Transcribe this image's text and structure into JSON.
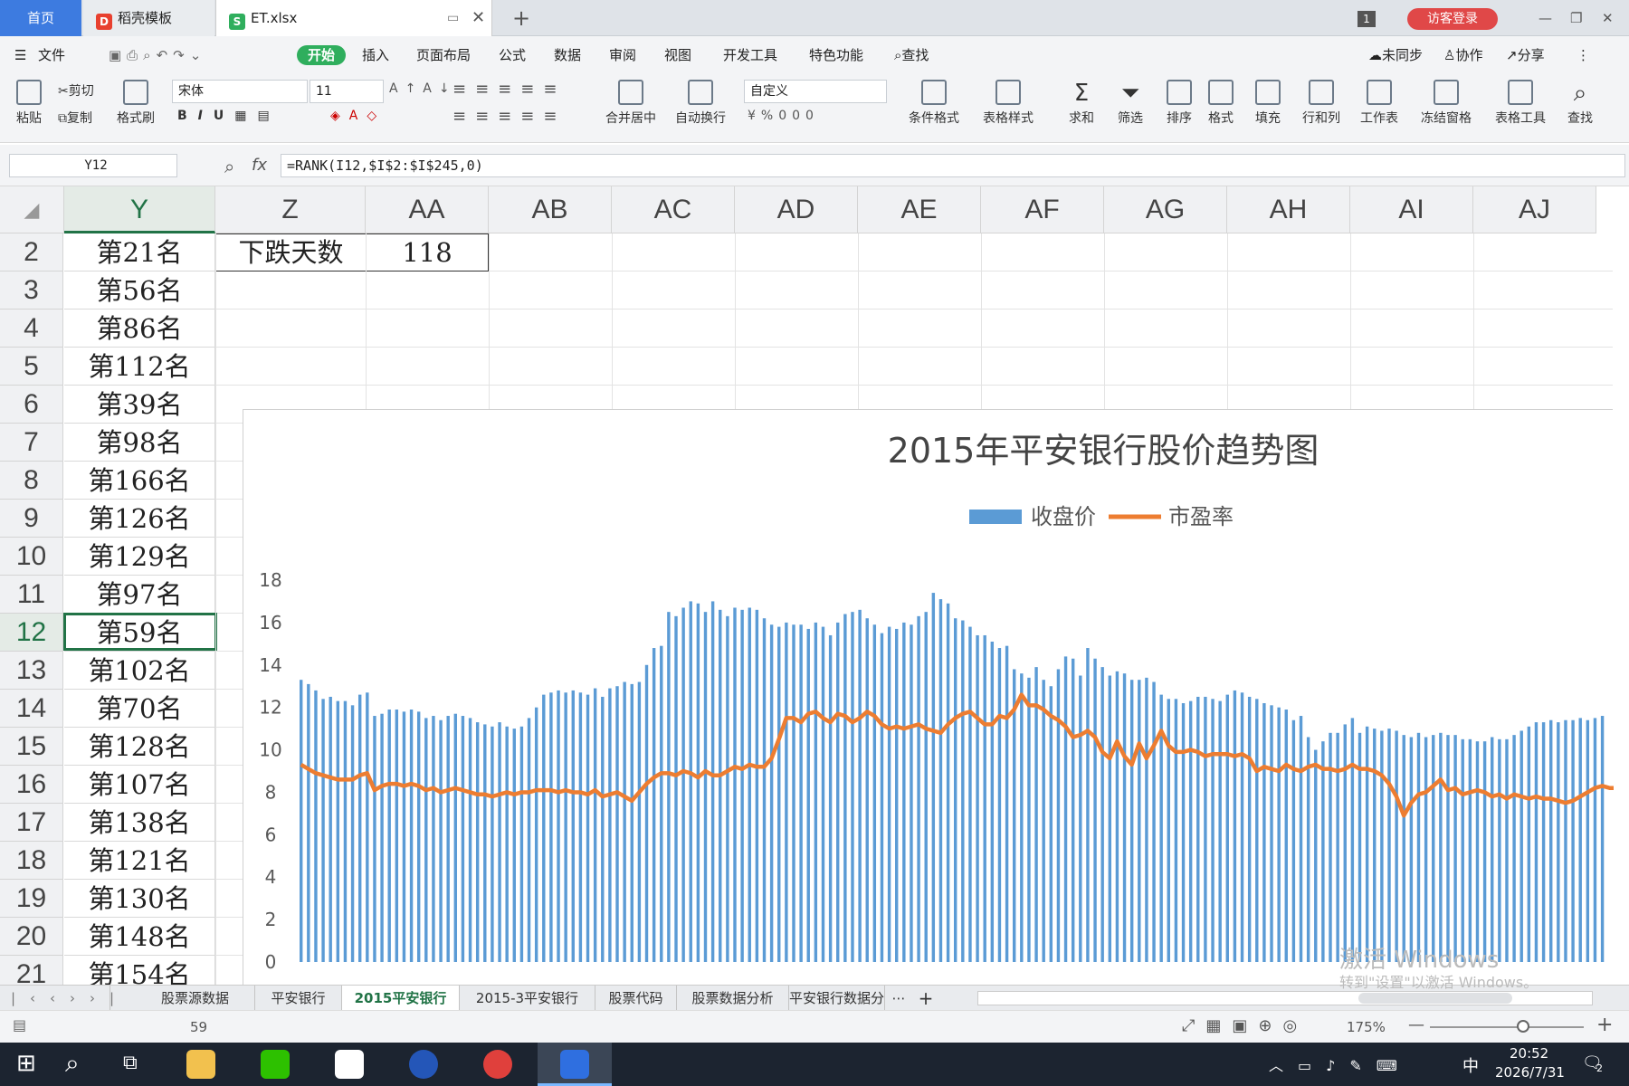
{
  "tabs": {
    "home": "首页",
    "docer": "稻壳模板",
    "file": "ET.xlsx",
    "badge": "1",
    "login": "访客登录"
  },
  "menu": {
    "file": "文件",
    "start": "开始",
    "insert": "插入",
    "layout": "页面布局",
    "formula": "公式",
    "data": "数据",
    "review": "审阅",
    "view": "视图",
    "dev": "开发工具",
    "special": "特色功能",
    "search": "查找",
    "unsync": "未同步",
    "collab": "协作",
    "share": "分享"
  },
  "ribbon": {
    "paste": "粘贴",
    "cut": "剪切",
    "copy": "复制",
    "format_painter": "格式刷",
    "font": "宋体",
    "size": "11",
    "merge": "合并居中",
    "wrap": "自动换行",
    "numfmt": "自定义",
    "cond": "条件格式",
    "tablestyle": "表格样式",
    "sum": "求和",
    "filter": "筛选",
    "sort": "排序",
    "format": "格式",
    "fill": "填充",
    "rowcol": "行和列",
    "sheet": "工作表",
    "freeze": "冻结窗格",
    "tabletool": "表格工具",
    "find": "查找"
  },
  "formula_bar": {
    "namebox": "Y12",
    "fx": "fx",
    "formula": "=RANK(I12,$I$2:$I$245,0)"
  },
  "columns": [
    "Y",
    "Z",
    "AA",
    "AB",
    "AC",
    "AD",
    "AE",
    "AF",
    "AG",
    "AH",
    "AI",
    "AJ"
  ],
  "rows": [
    {
      "n": "2",
      "y": "第21名"
    },
    {
      "n": "3",
      "y": "第56名"
    },
    {
      "n": "4",
      "y": "第86名"
    },
    {
      "n": "5",
      "y": "第112名"
    },
    {
      "n": "6",
      "y": "第39名"
    },
    {
      "n": "7",
      "y": "第98名"
    },
    {
      "n": "8",
      "y": "第166名"
    },
    {
      "n": "9",
      "y": "第126名"
    },
    {
      "n": "10",
      "y": "第129名"
    },
    {
      "n": "11",
      "y": "第97名"
    },
    {
      "n": "12",
      "y": "第59名"
    },
    {
      "n": "13",
      "y": "第102名"
    },
    {
      "n": "14",
      "y": "第70名"
    },
    {
      "n": "15",
      "y": "第128名"
    },
    {
      "n": "16",
      "y": "第107名"
    },
    {
      "n": "17",
      "y": "第138名"
    },
    {
      "n": "18",
      "y": "第121名"
    },
    {
      "n": "19",
      "y": "第130名"
    },
    {
      "n": "20",
      "y": "第148名"
    },
    {
      "n": "21",
      "y": "第154名"
    }
  ],
  "cells": {
    "Z2": "下跌天数",
    "AA2": "118"
  },
  "chart_data": {
    "type": "bar",
    "title": "2015年平安银行股价趋势图",
    "ylim": [
      0,
      18
    ],
    "yticks": [
      "0",
      "2",
      "4",
      "6",
      "8",
      "10",
      "12",
      "14",
      "16",
      "18"
    ],
    "series": [
      {
        "name": "收盘价",
        "type": "bar",
        "color": "#5b9bd5",
        "values": [
          13.3,
          13.1,
          12.8,
          12.4,
          12.5,
          12.3,
          12.3,
          12.1,
          12.6,
          12.7,
          11.6,
          11.7,
          11.9,
          11.9,
          11.8,
          11.9,
          11.8,
          11.5,
          11.6,
          11.4,
          11.6,
          11.7,
          11.6,
          11.5,
          11.3,
          11.2,
          11.1,
          11.3,
          11.1,
          11.0,
          11.1,
          11.5,
          12.0,
          12.6,
          12.7,
          12.8,
          12.7,
          12.8,
          12.7,
          12.6,
          12.9,
          12.5,
          12.9,
          13.0,
          13.2,
          13.1,
          13.2,
          14.0,
          14.8,
          14.9,
          16.5,
          16.3,
          16.7,
          17.0,
          16.9,
          16.5,
          17.0,
          16.6,
          16.3,
          16.7,
          16.6,
          16.7,
          16.6,
          16.2,
          15.9,
          15.8,
          16.0,
          15.9,
          15.9,
          15.7,
          16.0,
          15.8,
          15.4,
          16.0,
          16.4,
          16.5,
          16.6,
          16.2,
          15.9,
          15.5,
          15.8,
          15.7,
          16.0,
          15.9,
          16.3,
          16.5,
          17.4,
          17.1,
          16.9,
          16.2,
          16.1,
          15.8,
          15.4,
          15.4,
          15.1,
          14.8,
          14.9,
          13.8,
          13.6,
          13.4,
          13.9,
          13.3,
          13.0,
          13.8,
          14.4,
          14.3,
          13.5,
          14.8,
          14.3,
          13.9,
          13.5,
          13.7,
          13.6,
          13.3,
          13.3,
          13.4,
          13.2,
          12.6,
          12.4,
          12.4,
          12.2,
          12.3,
          12.5,
          12.5,
          12.4,
          12.3,
          12.6,
          12.8,
          12.7,
          12.5,
          12.4,
          12.2,
          12.1,
          12.0,
          11.9,
          11.4,
          11.6,
          10.6,
          10.0,
          10.4,
          10.8,
          10.8,
          11.2,
          11.5,
          10.8,
          11.1,
          11.0,
          10.9,
          11.0,
          10.9,
          10.7,
          10.6,
          10.8,
          10.6,
          10.7,
          10.8,
          10.7,
          10.7,
          10.5,
          10.5,
          10.4,
          10.4,
          10.6,
          10.5,
          10.5,
          10.7,
          10.9,
          11.1,
          11.3,
          11.3,
          11.4,
          11.3,
          11.4,
          11.4,
          11.5,
          11.4,
          11.5,
          11.6
        ]
      },
      {
        "name": "市盈率",
        "type": "line",
        "color": "#ed7d31",
        "values": [
          9.3,
          9.1,
          8.9,
          8.8,
          8.7,
          8.6,
          8.6,
          8.6,
          8.8,
          8.9,
          8.1,
          8.3,
          8.4,
          8.4,
          8.3,
          8.4,
          8.3,
          8.1,
          8.2,
          8.0,
          8.1,
          8.2,
          8.1,
          8.0,
          7.9,
          7.9,
          7.8,
          7.9,
          8.0,
          7.9,
          8.0,
          8.0,
          8.1,
          8.1,
          8.1,
          8.0,
          8.1,
          8.0,
          8.0,
          7.9,
          8.1,
          7.8,
          7.9,
          8.0,
          7.8,
          7.6,
          8.0,
          8.4,
          8.7,
          8.9,
          8.9,
          8.8,
          9.0,
          8.9,
          8.7,
          9.0,
          8.8,
          8.8,
          9.0,
          9.2,
          9.1,
          9.3,
          9.2,
          9.2,
          9.6,
          10.5,
          11.5,
          11.5,
          11.3,
          11.7,
          11.8,
          11.5,
          11.3,
          11.7,
          11.6,
          11.3,
          11.5,
          11.8,
          11.6,
          11.2,
          11.0,
          11.1,
          11.0,
          11.1,
          11.2,
          11.0,
          10.9,
          10.8,
          11.2,
          11.5,
          11.7,
          11.8,
          11.5,
          11.2,
          11.2,
          11.6,
          11.5,
          11.9,
          12.6,
          12.1,
          12.1,
          11.9,
          11.6,
          11.4,
          11.1,
          10.6,
          10.7,
          10.9,
          10.6,
          9.9,
          9.6,
          10.4,
          9.7,
          9.3,
          10.3,
          9.6,
          10.2,
          10.9,
          10.2,
          9.9,
          9.9,
          10.0,
          9.9,
          9.7,
          9.8,
          9.8,
          9.8,
          9.7,
          9.8,
          9.6,
          9.0,
          9.2,
          9.1,
          9.0,
          9.3,
          9.1,
          9.0,
          9.2,
          9.3,
          9.1,
          9.1,
          9.0,
          9.1,
          9.3,
          9.1,
          9.1,
          9.0,
          8.8,
          8.4,
          7.8,
          6.9,
          7.5,
          7.9,
          8.0,
          8.3,
          8.6,
          8.1,
          8.2,
          7.9,
          8.0,
          8.1,
          8.0,
          7.8,
          7.9,
          7.7,
          7.9,
          7.8,
          7.7,
          7.8,
          7.7,
          7.7,
          7.6,
          7.5,
          7.6,
          7.8,
          8.0,
          8.2,
          8.3,
          8.2,
          8.2,
          8.3,
          8.2,
          8.3,
          8.3,
          8.4,
          8.4
        ]
      }
    ]
  },
  "sheets": [
    "股票源数据",
    "平安银行",
    "2015平安银行",
    "2015-3平安银行",
    "股票代码",
    "股票数据分析",
    "平安银行数据分"
  ],
  "active_sheet": "2015平安银行",
  "watermark": {
    "line1": "激活 Windows",
    "line2": "转到\"设置\"以激活 Windows。"
  },
  "status": {
    "value": "59",
    "zoom": "175%"
  },
  "taskbar": {
    "ime": "中",
    "time": "20:52",
    "date": "2026/7/31",
    "notif": "2"
  },
  "colors": {
    "accent": "#2fae5d",
    "selection": "#217346",
    "brand": "#3d7be0"
  }
}
